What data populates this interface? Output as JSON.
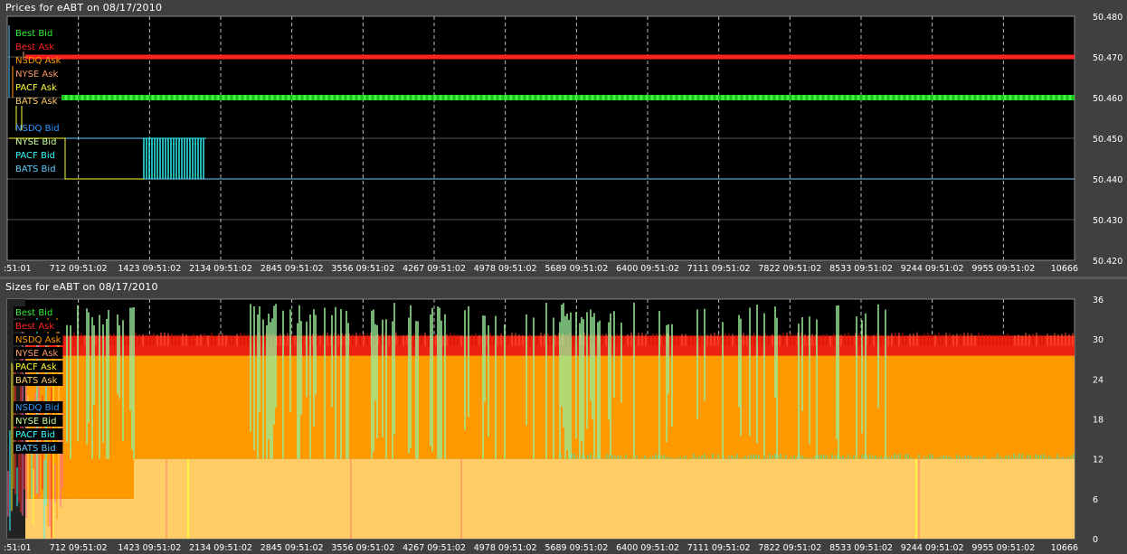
{
  "charts": {
    "prices": {
      "title": "Prices for  eABT  on  08/17/2010",
      "y_ticks": [
        "50.480",
        "50.470",
        "50.460",
        "50.450",
        "50.440",
        "50.430",
        "50.420"
      ],
      "x_ticks": [
        ":51:01",
        "712 09:51:02",
        "1423 09:51:02",
        "2134 09:51:02",
        "2845 09:51:02",
        "3556 09:51:02",
        "4267 09:51:02",
        "4978 09:51:02",
        "5689 09:51:02",
        "6400 09:51:02",
        "7111 09:51:02",
        "7822 09:51:02",
        "8533 09:51:02",
        "9244 09:51:02",
        "9955 09:51:02",
        "10666"
      ]
    },
    "sizes": {
      "title": "Sizes for  eABT  on  08/17/2010",
      "y_ticks": [
        "36",
        "30",
        "24",
        "18",
        "12",
        "6",
        "0"
      ],
      "x_ticks": [
        ":51:01",
        "712 09:51:02",
        "1423 09:51:02",
        "2134 09:51:02",
        "2845 09:51:02",
        "3556 09:51:02",
        "4267 09:51:02",
        "4978 09:51:02",
        "5689 09:51:02",
        "6400 09:51:02",
        "7111 09:51:02",
        "7822 09:51:02",
        "8533 09:51:02",
        "9244 09:51:02",
        "9955 09:51:02",
        "10666"
      ]
    }
  },
  "legend": [
    {
      "label": "Best Bid",
      "color": "#33ee33"
    },
    {
      "label": "Best Ask",
      "color": "#ff2222"
    },
    {
      "label": "NSDQ Ask",
      "color": "#ff9900"
    },
    {
      "label": "NYSE Ask",
      "color": "#ff9966"
    },
    {
      "label": "PACF Ask",
      "color": "#ffff33"
    },
    {
      "label": "BATS Ask",
      "color": "#ffcc66"
    },
    {
      "label": "NSDQ Bid",
      "color": "#3399ff"
    },
    {
      "label": "NYSE Bid",
      "color": "#ccff99"
    },
    {
      "label": "PACF Bid",
      "color": "#33ffff"
    },
    {
      "label": "BATS Bid",
      "color": "#66ccff"
    }
  ],
  "chart_data": [
    {
      "type": "line",
      "title": "Prices for  eABT  on  08/17/2010",
      "xlim": [
        0,
        10666
      ],
      "ylim": [
        50.42,
        50.48
      ],
      "grid": true,
      "legend_position": "top-left",
      "series": [
        {
          "name": "Best Ask",
          "color": "#ff2222",
          "x": [
            0,
            10666
          ],
          "y": [
            50.47,
            50.47
          ]
        },
        {
          "name": "Best Bid",
          "color": "#33ee33",
          "x": [
            0,
            10666
          ],
          "y": [
            50.46,
            50.46
          ]
        },
        {
          "name": "NSDQ Bid",
          "color": "#66ccff",
          "x": [
            0,
            1370,
            1370,
            10666
          ],
          "y": [
            50.45,
            50.45,
            50.44,
            50.44
          ]
        },
        {
          "name": "NYSE Bid",
          "color": "#ffff33",
          "x": [
            0,
            580,
            580,
            10666
          ],
          "y": [
            50.45,
            50.45,
            50.44,
            50.44
          ]
        }
      ]
    },
    {
      "type": "area",
      "title": "Sizes for  eABT  on  08/17/2010",
      "xlim": [
        0,
        10666
      ],
      "ylim": [
        0,
        36
      ],
      "grid": true,
      "legend_position": "top-left",
      "series": [
        {
          "name": "Best Ask",
          "color": "#ff2222",
          "x": [
            0,
            10666
          ],
          "y": [
            30,
            30
          ]
        },
        {
          "name": "NSDQ Ask",
          "color": "#ff9900",
          "x": [
            0,
            1300,
            1300,
            10666
          ],
          "y": [
            28,
            28,
            27,
            27
          ]
        },
        {
          "name": "BATS Ask",
          "color": "#ffcc66",
          "x": [
            0,
            1300,
            1300,
            9244,
            9244,
            10666
          ],
          "y": [
            6,
            6,
            12,
            12,
            12,
            12
          ]
        },
        {
          "name": "PACF Bid",
          "color": "#33ffff",
          "x": [
            0,
            5500,
            5500,
            10666
          ],
          "y": [
            12,
            12,
            14,
            14
          ]
        },
        {
          "name": "Best Bid",
          "color": "#99ee99",
          "x": [
            0,
            10666
          ],
          "y": [
            35,
            35
          ]
        }
      ]
    }
  ]
}
